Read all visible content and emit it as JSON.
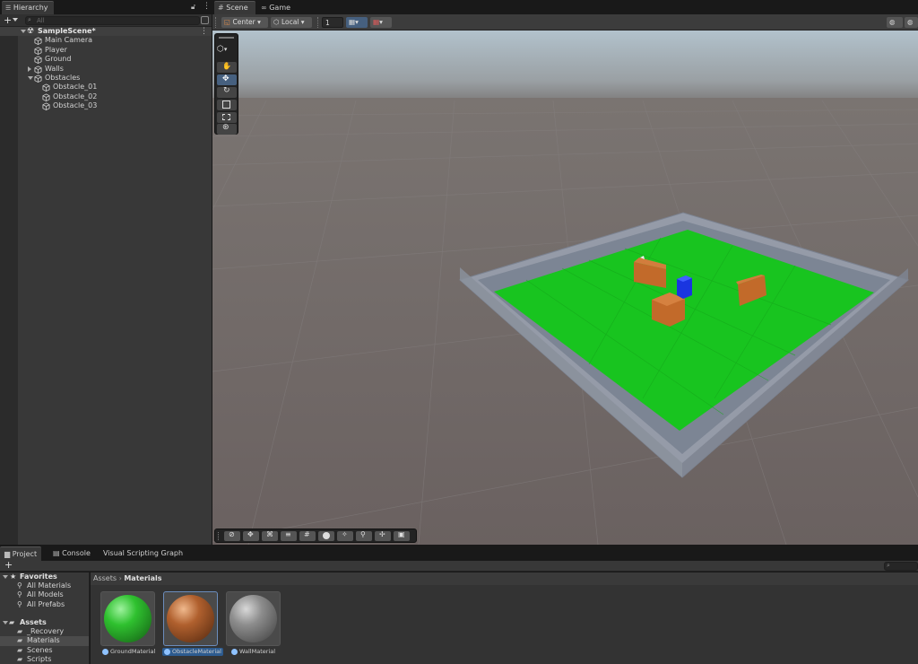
{
  "hierarchy": {
    "tab": "Hierarchy",
    "search_placeholder": "All",
    "add_label": "+",
    "rows": [
      {
        "label": "SampleScene*"
      },
      {
        "label": "Main Camera"
      },
      {
        "label": "Player"
      },
      {
        "label": "Ground"
      },
      {
        "label": "Walls"
      },
      {
        "label": "Obstacles"
      },
      {
        "label": "Obstacle_01"
      },
      {
        "label": "Obstacle_02"
      },
      {
        "label": "Obstacle_03"
      }
    ]
  },
  "scene": {
    "tabs": [
      {
        "label": "Scene"
      },
      {
        "label": "Game"
      }
    ],
    "pivot": "Center",
    "space": "Local",
    "grid_value": "1",
    "colors": {
      "sky": "#a8b4bf",
      "ground": "#6f6664",
      "floor": "#18c41f",
      "wall": "#8c94a2",
      "player": "#1a35e0",
      "obstacle": "#c26a2a"
    }
  },
  "project": {
    "tabs": [
      {
        "label": "Project"
      },
      {
        "label": "Console"
      },
      {
        "label": "Visual Scripting Graph"
      }
    ],
    "add_label": "+",
    "favorites": {
      "label": "Favorites",
      "items": [
        "All Materials",
        "All Models",
        "All Prefabs"
      ]
    },
    "assets": {
      "label": "Assets",
      "items": [
        "_Recovery",
        "Materials",
        "Scenes",
        "Scripts"
      ]
    },
    "breadcrumb": [
      "Assets",
      "Materials"
    ],
    "materials": [
      {
        "name": "GroundMaterial",
        "color": "#2fc12f"
      },
      {
        "name": "ObstacleMaterial",
        "color": "#b0602e"
      },
      {
        "name": "WallMaterial",
        "color": "#8d8d8d"
      }
    ]
  }
}
